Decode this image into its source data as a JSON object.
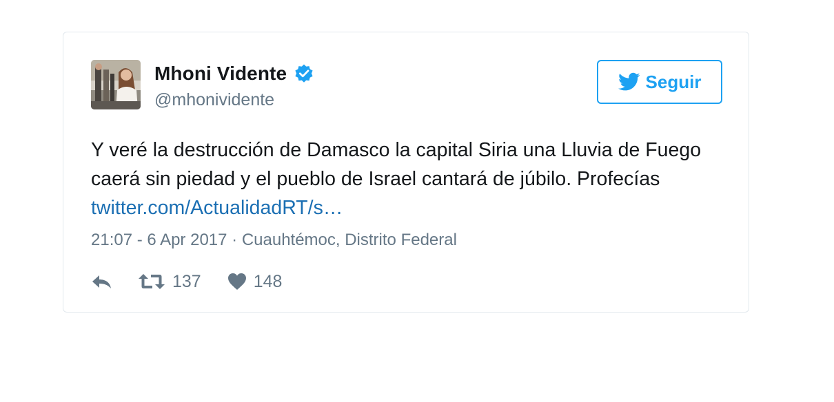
{
  "tweet": {
    "author": {
      "display_name": "Mhoni Vidente",
      "handle": "@mhonividente",
      "verified": true,
      "avatar_icon": "profile-photo"
    },
    "follow_button": {
      "label": "Seguir",
      "icon": "twitter-bird-icon"
    },
    "text_before_link": "Y veré la destrucción de Damasco la capital Siria una Lluvia de Fuego caerá sin piedad y el pueblo de Israel cantará de júbilo. Profecías ",
    "link_text": "twitter.com/ActualidadRT/s…",
    "timestamp": "21:07 - 6 Apr 2017",
    "separator": " · ",
    "location": "Cuauhtémoc, Distrito Federal",
    "actions": {
      "reply_icon": "reply-icon",
      "retweet_icon": "retweet-icon",
      "retweet_count": "137",
      "like_icon": "heart-icon",
      "like_count": "148"
    }
  },
  "colors": {
    "accent": "#1da1f2",
    "link": "#1b6fb3",
    "text": "#14171a",
    "muted": "#657786",
    "border": "#e1e8ed"
  }
}
